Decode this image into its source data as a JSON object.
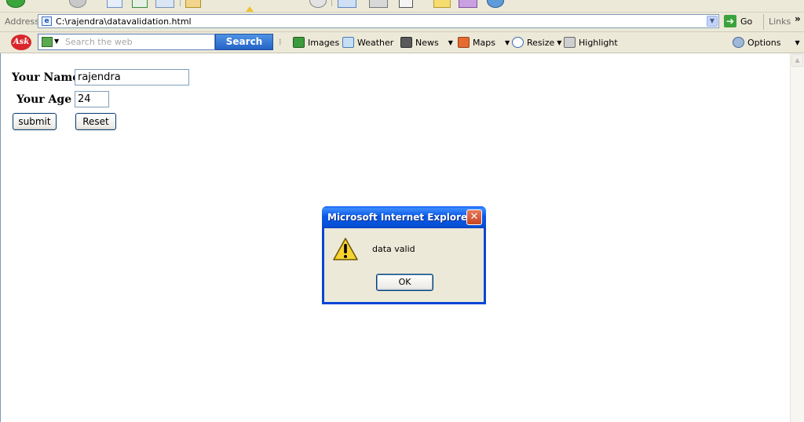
{
  "toolbar_icons": [
    "back-icon",
    "forward-icon",
    "stop-icon",
    "refresh-icon",
    "home-icon",
    "search-icon",
    "favorites-icon",
    "media-icon",
    "mail-icon",
    "print-icon",
    "edit-icon",
    "discuss-icon",
    "messenger-icon",
    "globe-icon"
  ],
  "address_bar": {
    "label": "Address",
    "url": "C:\\rajendra\\datavalidation.html",
    "go_label": "Go",
    "links_label": "Links",
    "chevron": "»"
  },
  "ask_toolbar": {
    "logo": "Ask",
    "search_placeholder": "Search the web",
    "search_button": "Search",
    "items": {
      "images": "Images",
      "weather": "Weather",
      "news": "News",
      "maps": "Maps",
      "resize": "Resize",
      "highlight": "Highlight",
      "options": "Options"
    }
  },
  "form": {
    "name_label": "Your Name",
    "name_value": "rajendra",
    "age_label": "Your Age",
    "age_value": "24",
    "submit_label": "submit",
    "reset_label": "Reset"
  },
  "alert": {
    "title": "Microsoft Internet Explorer",
    "message": "data valid",
    "ok_label": "OK",
    "icon": "warning-icon"
  },
  "colors": {
    "chrome": "#ece9d8",
    "titlebar_blue": "#0552d9",
    "close_red": "#c8451f",
    "ask_search_blue": "#2463c7",
    "input_border": "#7f9db9"
  }
}
